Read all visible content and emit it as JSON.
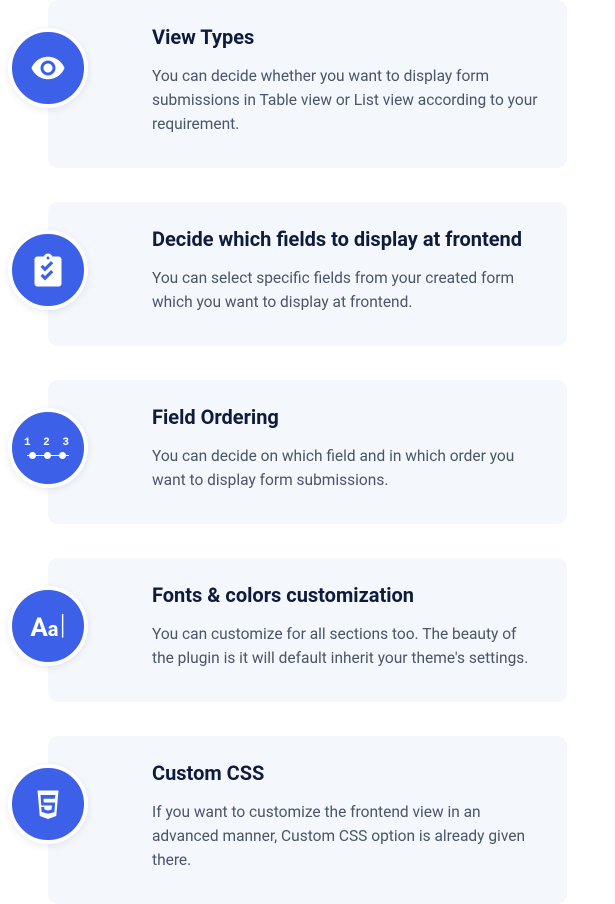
{
  "features": [
    {
      "icon": "eye-icon",
      "title": "View Types",
      "description": "You can decide whether you want to display form submissions in Table view or List view according to your requirement."
    },
    {
      "icon": "clipboard-icon",
      "title": "Decide which fields to display at frontend",
      "description": "You can select specific fields from your created form which you want to display at frontend."
    },
    {
      "icon": "ordering-icon",
      "title": "Field Ordering",
      "description": "You can decide on which field and in which order you want to display form submissions."
    },
    {
      "icon": "font-icon",
      "title": "Fonts & colors customization",
      "description": "You can customize for all sections too. The beauty of the plugin is it will default inherit your theme's settings."
    },
    {
      "icon": "css-icon",
      "title": "Custom CSS",
      "description": "If you want to customize the frontend view in an advanced manner, Custom CSS option is already given there."
    }
  ]
}
